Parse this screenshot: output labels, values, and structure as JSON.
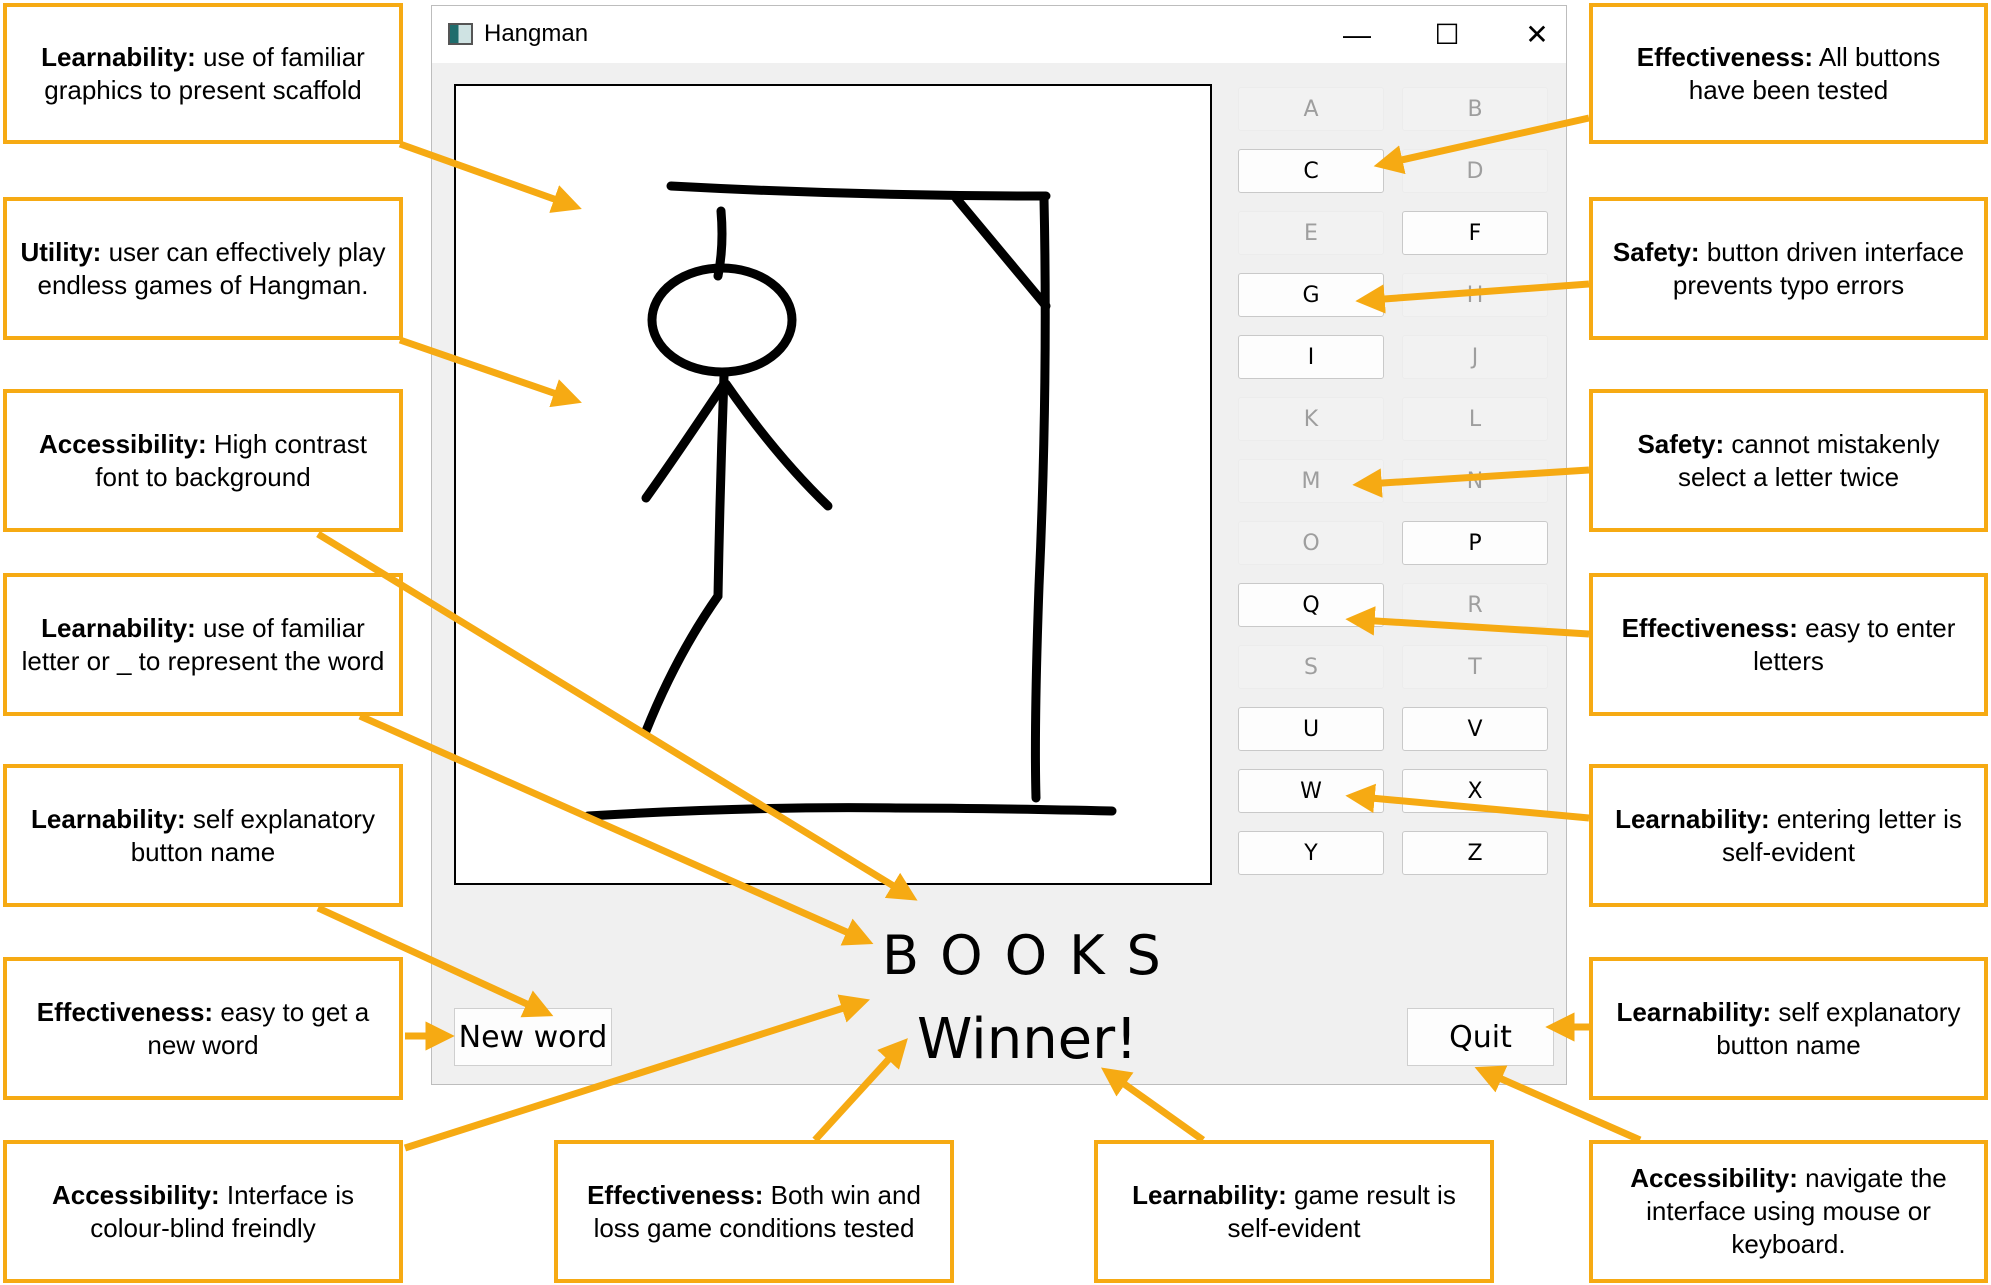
{
  "window": {
    "title": "Hangman",
    "minimize_glyph": "—",
    "maximize_glyph": "☐",
    "close_glyph": "✕"
  },
  "letters": [
    {
      "label": "A",
      "enabled": false
    },
    {
      "label": "B",
      "enabled": false
    },
    {
      "label": "C",
      "enabled": true
    },
    {
      "label": "D",
      "enabled": false
    },
    {
      "label": "E",
      "enabled": false
    },
    {
      "label": "F",
      "enabled": true
    },
    {
      "label": "G",
      "enabled": true
    },
    {
      "label": "H",
      "enabled": false
    },
    {
      "label": "I",
      "enabled": true
    },
    {
      "label": "J",
      "enabled": false
    },
    {
      "label": "K",
      "enabled": false
    },
    {
      "label": "L",
      "enabled": false
    },
    {
      "label": "M",
      "enabled": false
    },
    {
      "label": "N",
      "enabled": false
    },
    {
      "label": "O",
      "enabled": false
    },
    {
      "label": "P",
      "enabled": true
    },
    {
      "label": "Q",
      "enabled": true
    },
    {
      "label": "R",
      "enabled": false
    },
    {
      "label": "S",
      "enabled": false
    },
    {
      "label": "T",
      "enabled": false
    },
    {
      "label": "U",
      "enabled": true
    },
    {
      "label": "V",
      "enabled": true
    },
    {
      "label": "W",
      "enabled": true
    },
    {
      "label": "X",
      "enabled": true
    },
    {
      "label": "Y",
      "enabled": true
    },
    {
      "label": "Z",
      "enabled": true
    }
  ],
  "game": {
    "word": "BOOKS",
    "result": "Winner!",
    "new_word_label": "New word",
    "quit_label": "Quit"
  },
  "annotations": {
    "left": [
      {
        "category": "Learnability:",
        "text": "use of familiar graphics to present scaffold"
      },
      {
        "category": "Utility:",
        "text": "user can effectively play endless games of Hangman."
      },
      {
        "category": "Accessibility:",
        "text": "High contrast font to background"
      },
      {
        "category": "Learnability:",
        "text": "use of familiar letter or _ to represent the word"
      },
      {
        "category": "Learnability:",
        "text": "self explanatory button name"
      },
      {
        "category": "Effectiveness:",
        "text": "easy to get a new word"
      },
      {
        "category": "Accessibility:",
        "text": "Interface is colour-blind freindly"
      }
    ],
    "right": [
      {
        "category": "Effectiveness:",
        "text": "All buttons have been tested"
      },
      {
        "category": "Safety:",
        "text": "button driven interface prevents typo errors"
      },
      {
        "category": "Safety:",
        "text": "cannot mistakenly select a letter twice"
      },
      {
        "category": "Effectiveness:",
        "text": "easy to enter letters"
      },
      {
        "category": "Learnability:",
        "text": "entering letter is self-evident"
      },
      {
        "category": "Learnability:",
        "text": "self explanatory button name"
      },
      {
        "category": "Accessibility:",
        "text": "navigate the interface using mouse or keyboard."
      }
    ],
    "bottom": [
      {
        "category": "Effectiveness:",
        "text": "Both win and loss game conditions tested"
      },
      {
        "category": "Learnability:",
        "text": "game result is self-evident"
      }
    ]
  },
  "colors": {
    "annotation_border": "#f6aa13",
    "arrow": "#f6aa13",
    "window_bg": "#f0f0f0",
    "disabled_letter_text": "#9e9e9e"
  }
}
